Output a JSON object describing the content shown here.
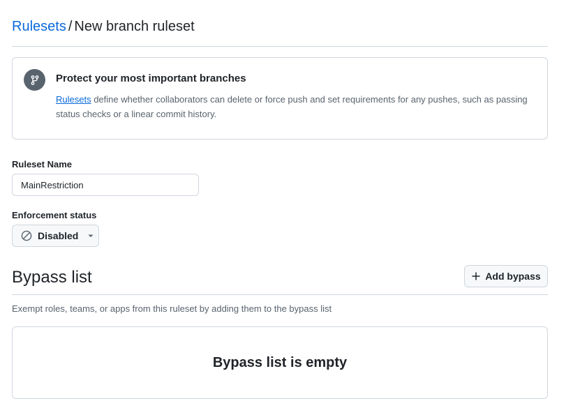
{
  "breadcrumb": {
    "parent": "Rulesets",
    "separator": "/",
    "current": "New branch ruleset"
  },
  "info": {
    "icon": "git-branch-icon",
    "title": "Protect your most important branches",
    "link_text": "Rulesets",
    "description": " define whether collaborators can delete or force push and set requirements for any pushes, such as passing status checks or a linear commit history."
  },
  "ruleset_name": {
    "label": "Ruleset Name",
    "value": "MainRestriction"
  },
  "enforcement": {
    "label": "Enforcement status",
    "selected": "Disabled",
    "icon": "circle-slash-icon"
  },
  "bypass": {
    "title": "Bypass list",
    "add_button_label": "Add bypass",
    "description": "Exempt roles, teams, or apps from this ruleset by adding them to the bypass list",
    "empty_text": "Bypass list is empty"
  },
  "colors": {
    "link": "#0969da",
    "border": "#d0d7de",
    "muted_text": "#59636e",
    "button_bg": "#f6f8fa"
  }
}
